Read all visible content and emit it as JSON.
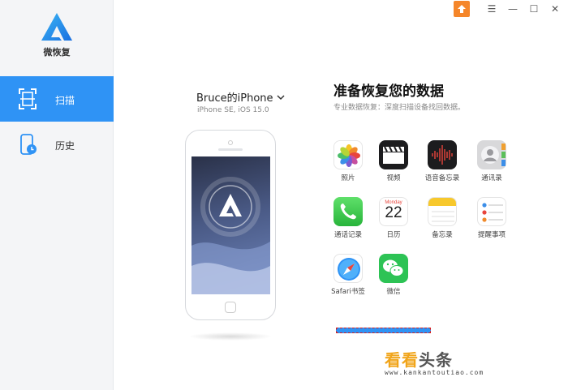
{
  "app": {
    "name": "微恢复"
  },
  "colors": {
    "accent": "#2f93f5",
    "upgrade": "#f5862a",
    "progress_border": "#d91c1c"
  },
  "window_controls": {
    "menu": "☰",
    "minimize": "—",
    "maximize": "☐",
    "close": "✕"
  },
  "sidebar": {
    "items": [
      {
        "label": "扫描",
        "icon": "scan-icon",
        "active": true
      },
      {
        "label": "历史",
        "icon": "history-icon",
        "active": false
      }
    ]
  },
  "device": {
    "name": "Bruce的iPhone",
    "model": "iPhone SE,  iOS 15.0"
  },
  "main": {
    "title": "准备恢复您的数据",
    "subtitle": "专业数据恢复：深度扫描设备找回数据。",
    "apps": [
      {
        "label": "照片",
        "icon": "photos-icon"
      },
      {
        "label": "视频",
        "icon": "videos-icon"
      },
      {
        "label": "语音备忘录",
        "icon": "voice-memos-icon"
      },
      {
        "label": "通讯录",
        "icon": "contacts-icon"
      },
      {
        "label": "通话记录",
        "icon": "phone-icon"
      },
      {
        "label": "日历",
        "icon": "calendar-icon",
        "calendar_month": "Monday",
        "calendar_day": "22"
      },
      {
        "label": "备忘录",
        "icon": "notes-icon"
      },
      {
        "label": "提醒事项",
        "icon": "reminders-icon"
      },
      {
        "label": "Safari书签",
        "icon": "safari-icon"
      },
      {
        "label": "微信",
        "icon": "wechat-icon"
      }
    ]
  },
  "watermark": {
    "part1": "看看",
    "part2": "头条",
    "url": "www.kankantoutiao.com"
  }
}
